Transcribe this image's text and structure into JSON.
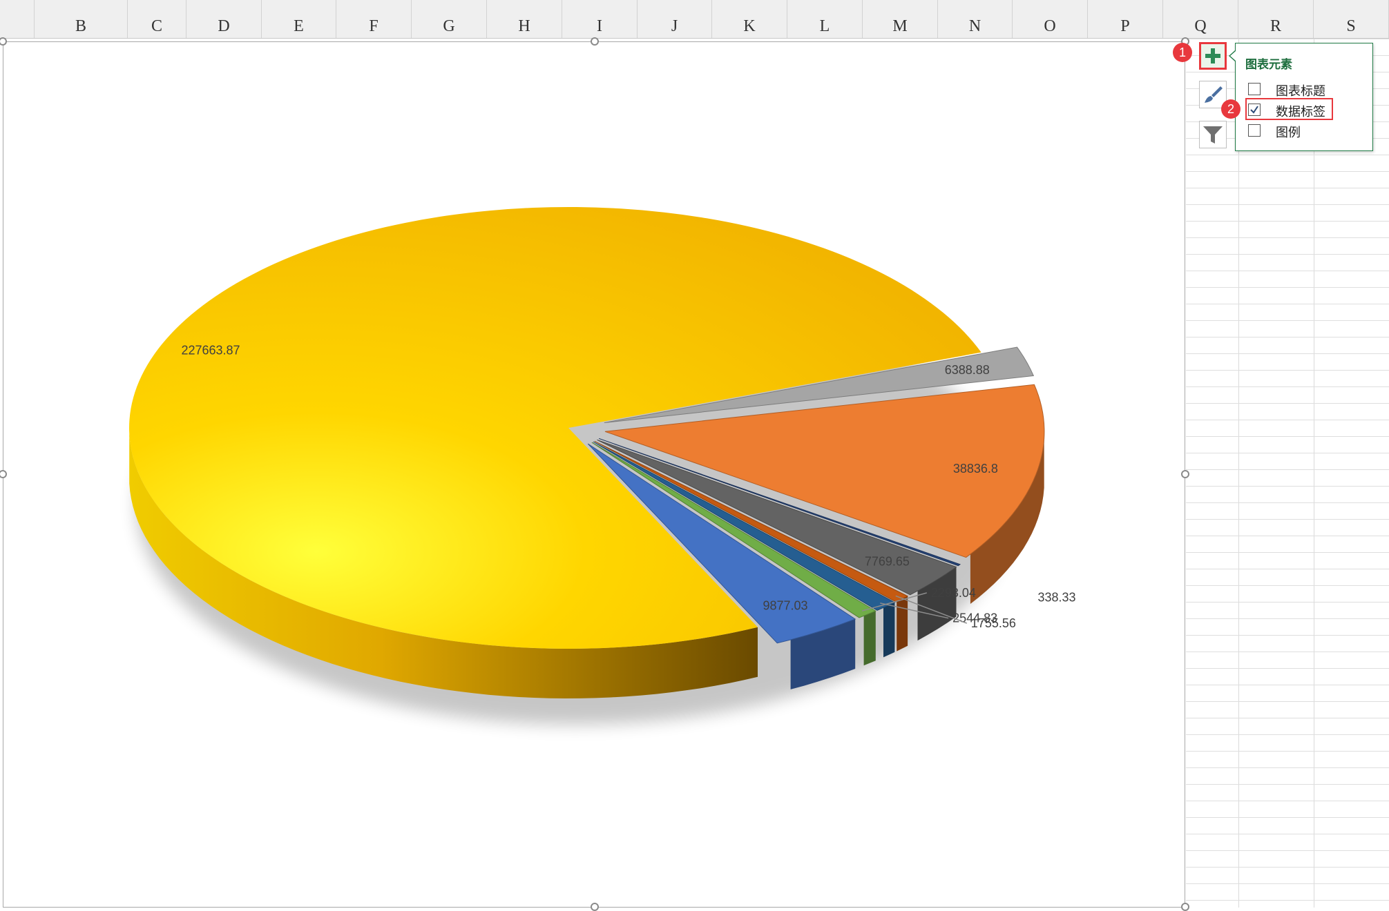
{
  "sheet": {
    "column_letters": [
      "B",
      "C",
      "D",
      "E",
      "F",
      "G",
      "H",
      "I",
      "J",
      "K",
      "L",
      "M",
      "N",
      "O",
      "P",
      "Q",
      "R",
      "S"
    ]
  },
  "chart_data": {
    "type": "pie",
    "title": "",
    "style": "3d-exploded",
    "legend": "none",
    "data_labels_visible": true,
    "slices": [
      {
        "value": 227663.87,
        "label": "227663.87",
        "color": "#f7bd00"
      },
      {
        "value": 9877.03,
        "label": "9877.03",
        "color": "#4472c4"
      },
      {
        "value": 2293.04,
        "label": "2293.04",
        "color": "#70ad47"
      },
      {
        "value": 2544.83,
        "label": "2544.83",
        "color": "#255e91"
      },
      {
        "value": 1755.56,
        "label": "1755.56",
        "color": "#c55a11"
      },
      {
        "value": 7769.65,
        "label": "7769.65",
        "color": "#636363"
      },
      {
        "value": 338.33,
        "label": "338.33",
        "color": "#264478"
      },
      {
        "value": 38836.8,
        "label": "38836.8",
        "color": "#ed7d31"
      },
      {
        "value": 6388.88,
        "label": "6388.88",
        "color": "#a5a5a5"
      }
    ]
  },
  "side_panel": {
    "buttons": [
      {
        "id": "chart-elements",
        "icon": "plus-icon",
        "color": "#2e8b57"
      },
      {
        "id": "chart-styles",
        "icon": "brush-icon"
      },
      {
        "id": "chart-filters",
        "icon": "filter-icon"
      }
    ],
    "popup": {
      "title": "图表元素",
      "items": [
        {
          "label": "图表标题",
          "checked": false
        },
        {
          "label": "数据标签",
          "checked": true
        },
        {
          "label": "图例",
          "checked": false
        }
      ]
    },
    "step_badges": [
      "1",
      "2"
    ],
    "accent_color": "#e8383d"
  }
}
